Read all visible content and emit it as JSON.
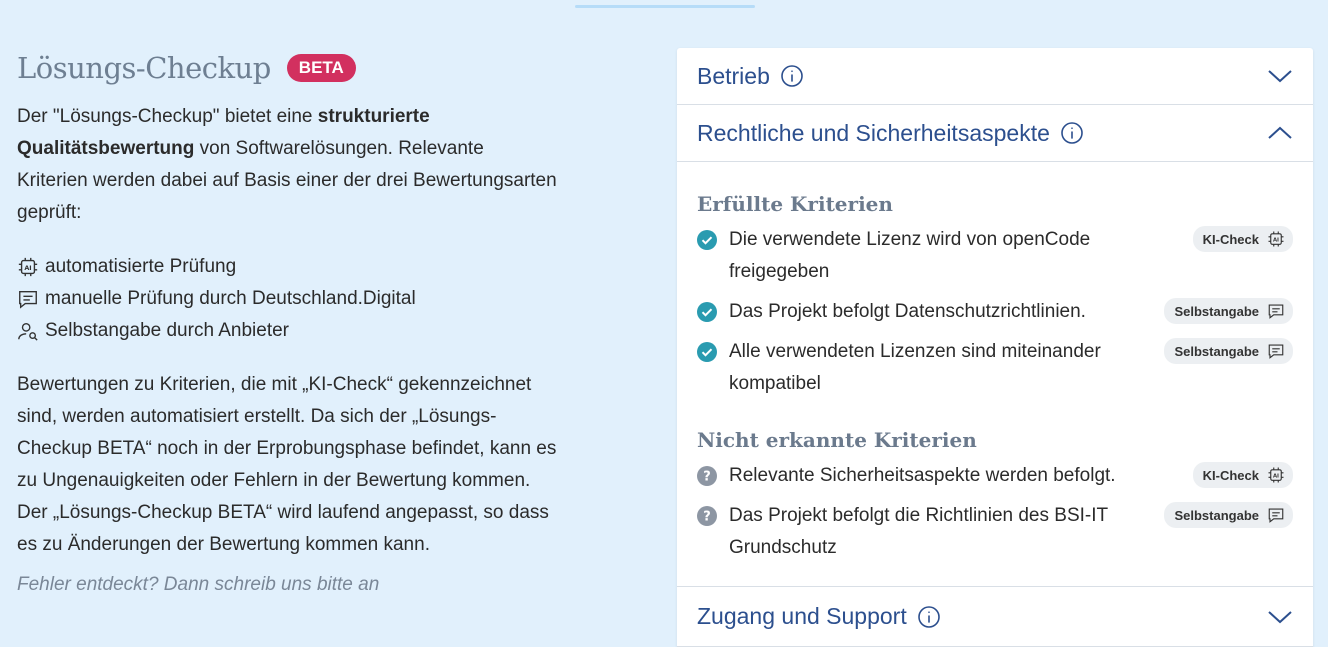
{
  "left": {
    "title": "Lösungs-Checkup",
    "beta_badge": "BETA",
    "intro_part1": "Der \"Lösungs-Checkup\" bietet eine ",
    "intro_bold": "strukturierte Qualitätsbewertung",
    "intro_part2": " von Softwarelösungen. Relevante Kriterien werden dabei auf Basis einer der drei Bewertungsarten geprüft:",
    "methods": [
      {
        "icon": "ai-chip-icon",
        "label": "automatisierte Prüfung"
      },
      {
        "icon": "comment-icon",
        "label": "manuelle Prüfung durch Deutschland.Digital"
      },
      {
        "icon": "user-search-icon",
        "label": "Selbstangabe durch Anbieter"
      }
    ],
    "disclaimer": "Bewertungen zu Kriterien, die mit „KI-Check“ gekennzeichnet sind, werden automatisiert erstellt. Da sich der „Lösungs-Checkup BETA“ noch in der Erprobungsphase befindet, kann es zu Ungenauigkeiten oder Fehlern in der Bewertung kommen. Der „Lösungs-Checkup BETA“ wird laufend angepasst, so dass es zu Änderungen der Bewertung kommen kann.",
    "found_error": "Fehler entdeckt? Dann schreib uns bitte an"
  },
  "panel": {
    "sections": [
      {
        "title": "Betrieb",
        "expanded": false
      },
      {
        "title": "Rechtliche und Sicherheitsaspekte",
        "expanded": true
      },
      {
        "title": "Zugang und Support",
        "expanded": false
      }
    ],
    "fulfilled_title": "Erfüllte Kriterien",
    "fulfilled": [
      {
        "text": "Die verwendete Lizenz wird von openCode freigegeben",
        "badge": "KI-Check",
        "badge_icon": "ai-chip-icon"
      },
      {
        "text": "Das Projekt befolgt Datenschutzrichtlinien.",
        "badge": "Selbstangabe",
        "badge_icon": "comment-icon"
      },
      {
        "text": "Alle verwendeten Lizenzen sind miteinander kompatibel",
        "badge": "Selbstangabe",
        "badge_icon": "comment-icon"
      }
    ],
    "unknown_title": "Nicht erkannte Kriterien",
    "unknown": [
      {
        "text": "Relevante Sicherheitsaspekte werden befolgt.",
        "badge": "KI-Check",
        "badge_icon": "ai-chip-icon"
      },
      {
        "text": "Das Projekt befolgt die Richtlinien des BSI-IT Grundschutz",
        "badge": "Selbstangabe",
        "badge_icon": "comment-icon"
      }
    ]
  },
  "colors": {
    "background": "#e1f0fc",
    "accent_blue": "#2c4f8e",
    "beta": "#d2305f",
    "check_teal": "#2a9bb0",
    "unknown_gray": "#8d96a3"
  }
}
